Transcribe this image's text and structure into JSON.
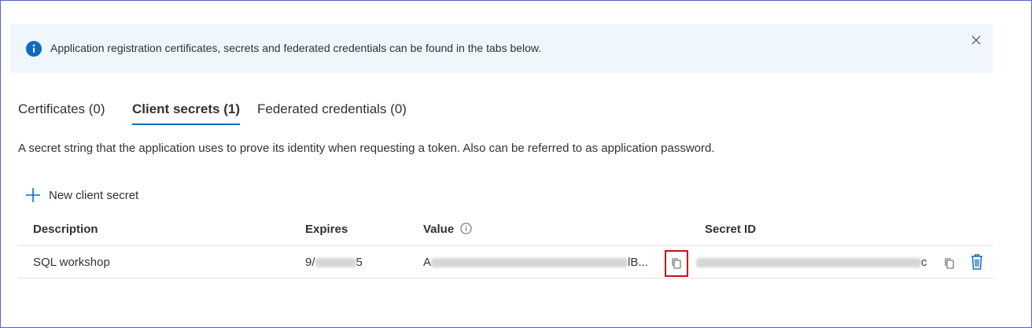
{
  "banner": {
    "message": "Application registration certificates, secrets and federated credentials can be found in the tabs below.",
    "icon": "info-icon",
    "close_icon": "close-icon"
  },
  "tabs": [
    {
      "label": "Certificates (0)",
      "active": false
    },
    {
      "label": "Client secrets (1)",
      "active": true
    },
    {
      "label": "Federated credentials (0)",
      "active": false
    }
  ],
  "description": "A secret string that the application uses to prove its identity when requesting a token. Also can be referred to as application password.",
  "toolbar": {
    "new_secret_label": "New client secret",
    "new_secret_icon": "plus-icon"
  },
  "table": {
    "headers": {
      "description": "Description",
      "expires": "Expires",
      "value": "Value",
      "secret_id": "Secret ID"
    },
    "rows": [
      {
        "description": "SQL workshop",
        "expires_prefix": "9/",
        "expires_suffix": "5",
        "value_prefix": "A",
        "value_suffix": "lB...",
        "secret_id_prefix": "",
        "secret_id_suffix": "c"
      }
    ]
  },
  "colors": {
    "accent": "#0f6cbd",
    "banner_bg": "#eff6fc",
    "highlight": "#c50f1f"
  }
}
